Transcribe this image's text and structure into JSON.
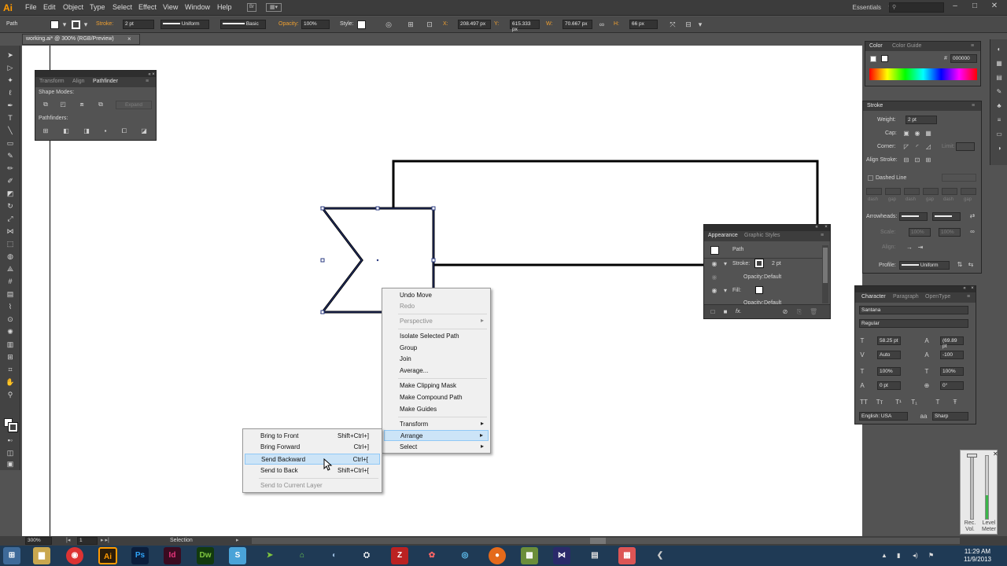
{
  "app": {
    "logo": "Ai",
    "menus": [
      "File",
      "Edit",
      "Object",
      "Type",
      "Select",
      "Effect",
      "View",
      "Window",
      "Help"
    ],
    "workspace": "Essentials",
    "win_min": "–",
    "win_max": "□",
    "win_close": "✕"
  },
  "control_bar": {
    "selection_type": "Path",
    "stroke_label": "Stroke:",
    "stroke_weight": "2 pt",
    "profile": "Uniform",
    "brush": "Basic",
    "opacity_label": "Opacity:",
    "opacity": "100%",
    "style_label": "Style:",
    "x_label": "X:",
    "x": "208.497 px",
    "y_label": "Y:",
    "y": "615.333 px",
    "w_label": "W:",
    "w": "70.667 px",
    "h_label": "H:",
    "h": "66 px"
  },
  "document_tab": {
    "title": "working.ai* @ 300% (RGB/Preview)",
    "close": "×"
  },
  "pathfinder_panel": {
    "tabs": [
      "Transform",
      "Align",
      "Pathfinder"
    ],
    "shape_modes_label": "Shape Modes:",
    "expand_label": "Expand",
    "pathfinders_label": "Pathfinders:"
  },
  "color_panel": {
    "tabs": [
      "Color",
      "Color Guide"
    ],
    "hex_label": "#",
    "hex": "000000"
  },
  "stroke_panel": {
    "title": "Stroke",
    "weight_label": "Weight:",
    "weight": "2 pt",
    "cap_label": "Cap:",
    "corner_label": "Corner:",
    "limit_label": "Limit:",
    "align_label": "Align Stroke:",
    "dashed_label": "Dashed Line",
    "dash_labels": [
      "dash",
      "gap",
      "dash",
      "gap",
      "dash",
      "gap"
    ],
    "arrowheads_label": "Arrowheads:",
    "scale_label": "Scale:",
    "scale1": "100%",
    "scale2": "100%",
    "align2_label": "Align:",
    "profile_label": "Profile:",
    "profile": "Uniform"
  },
  "appearance_panel": {
    "tabs": [
      "Appearance",
      "Graphic Styles"
    ],
    "object": "Path",
    "stroke_label": "Stroke:",
    "stroke_value": "2 pt",
    "opacity_label": "Opacity:",
    "opacity_value": "Default",
    "fill_label": "Fill:",
    "opacity2_value": "Default",
    "fx": "fx."
  },
  "character_panel": {
    "tabs": [
      "Character",
      "Paragraph",
      "OpenType"
    ],
    "font": "Santana",
    "style": "Regular",
    "size": "58.25 pt",
    "leading": "(69.89 pt",
    "kerning": "Auto",
    "tracking": "-100",
    "vscale": "100%",
    "hscale": "100%",
    "baseline": "0 pt",
    "rotation": "0°",
    "language": "English: USA",
    "antialias": "Sharp"
  },
  "context_menu": {
    "items": [
      {
        "label": "Undo Move",
        "enabled": true
      },
      {
        "label": "Redo",
        "enabled": false
      },
      {
        "label": "Perspective",
        "enabled": false,
        "submenu": true
      },
      {
        "label": "Isolate Selected Path",
        "enabled": true
      },
      {
        "label": "Group",
        "enabled": true
      },
      {
        "label": "Join",
        "enabled": true
      },
      {
        "label": "Average...",
        "enabled": true
      },
      {
        "label": "Make Clipping Mask",
        "enabled": true
      },
      {
        "label": "Make Compound Path",
        "enabled": true
      },
      {
        "label": "Make Guides",
        "enabled": true
      },
      {
        "label": "Transform",
        "enabled": true,
        "submenu": true
      },
      {
        "label": "Arrange",
        "enabled": true,
        "submenu": true,
        "highlighted": true
      },
      {
        "label": "Select",
        "enabled": true,
        "submenu": true
      }
    ]
  },
  "arrange_submenu": {
    "items": [
      {
        "label": "Bring to Front",
        "shortcut": "Shift+Ctrl+]"
      },
      {
        "label": "Bring Forward",
        "shortcut": "Ctrl+]"
      },
      {
        "label": "Send Backward",
        "shortcut": "Ctrl+[",
        "highlighted": true
      },
      {
        "label": "Send to Back",
        "shortcut": "Shift+Ctrl+["
      },
      {
        "label": "Send to Current Layer",
        "shortcut": "",
        "enabled": false
      }
    ]
  },
  "status_bar": {
    "zoom": "300%",
    "page": "1",
    "tool": "Selection"
  },
  "audio_meter": {
    "rec_label": "Rec. Vol.",
    "level_label": "Level Meter"
  },
  "taskbar": {
    "time": "11:29 AM",
    "date": "11/9/2013",
    "apps": [
      "Ai",
      "Ps",
      "Id",
      "Dw"
    ]
  },
  "colors": {
    "ai_brand": "#ff9a00",
    "ps_brand": "#2fa3f7",
    "id_brand": "#e8357c",
    "dw_brand": "#7fc63f",
    "accent_orange": "#f0a030"
  }
}
